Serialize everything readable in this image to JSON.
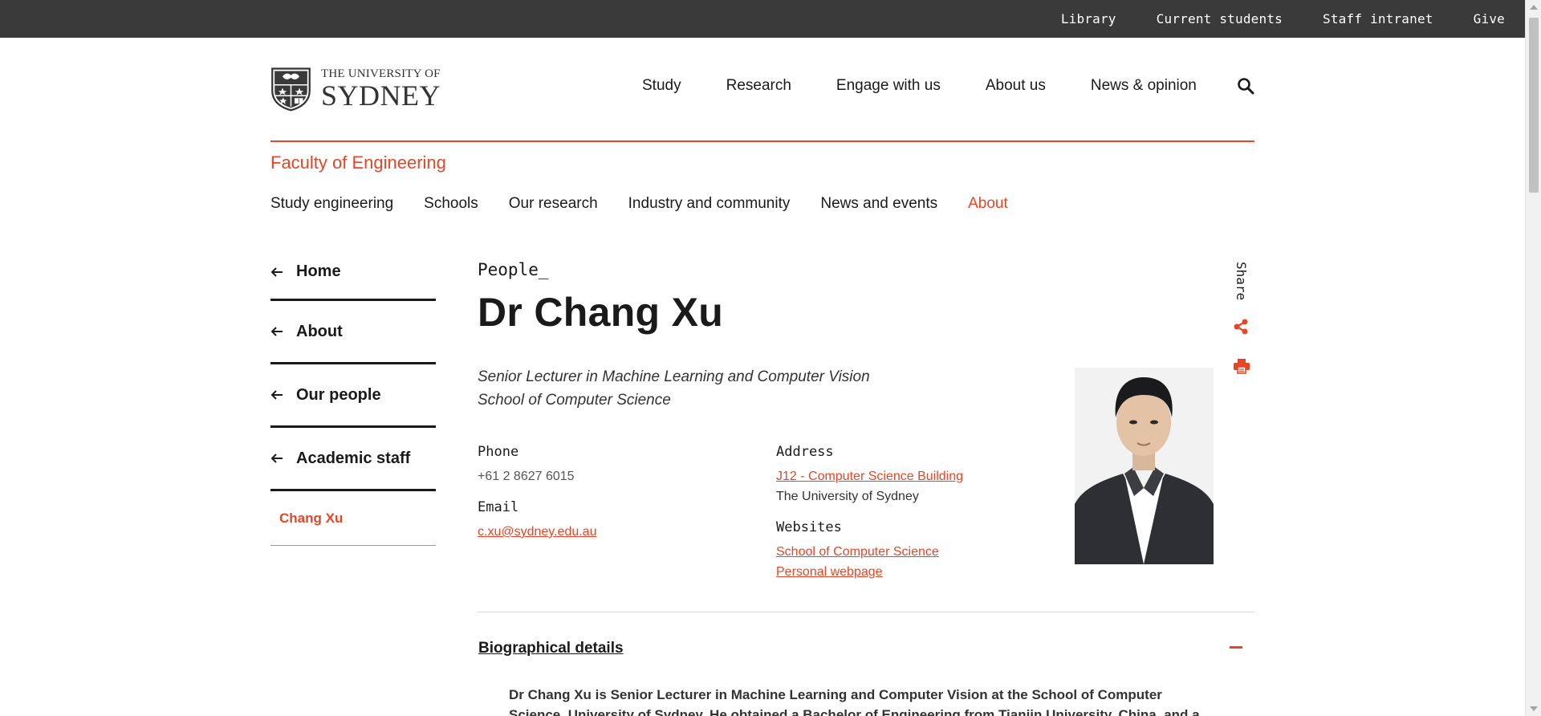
{
  "utility_nav": [
    "Library",
    "Current students",
    "Staff intranet",
    "Give"
  ],
  "logo": {
    "line1": "THE UNIVERSITY OF",
    "line2": "SYDNEY"
  },
  "main_nav": [
    "Study",
    "Research",
    "Engage with us",
    "About us",
    "News & opinion"
  ],
  "faculty": "Faculty of Engineering",
  "sub_nav": {
    "items": [
      "Study engineering",
      "Schools",
      "Our research",
      "Industry and community",
      "News and events",
      "About"
    ],
    "active": "About"
  },
  "sidebar": {
    "items": [
      "Home",
      "About",
      "Our people",
      "Academic staff"
    ],
    "current": "Chang Xu"
  },
  "profile": {
    "eyebrow": "People_",
    "name": "Dr Chang Xu",
    "role": "Senior Lecturer in Machine Learning and Computer Vision",
    "school": "School of Computer Science",
    "phone_label": "Phone",
    "phone": "+61 2 8627 6015",
    "email_label": "Email",
    "email": "c.xu@sydney.edu.au",
    "address_label": "Address",
    "address_link": "J12 - Computer Science Building",
    "address_line2": "The University of Sydney",
    "websites_label": "Websites",
    "websites": [
      "School of Computer Science",
      "Personal webpage"
    ]
  },
  "share_label": "Share",
  "accordion": {
    "title": "Biographical details",
    "text": "Dr Chang Xu is Senior Lecturer in Machine Learning and Computer Vision at the School of Computer Science, University of Sydney. He obtained a Bachelor of Engineering from Tianjin University, China, and a Ph.D. degree"
  },
  "colors": {
    "accent": "#e64626",
    "utility_bar": "#3a3a3a",
    "text": "#1a1a1a"
  },
  "icons": [
    "search-icon",
    "back-arrow-icon",
    "share-icon",
    "print-icon",
    "minus-icon"
  ]
}
